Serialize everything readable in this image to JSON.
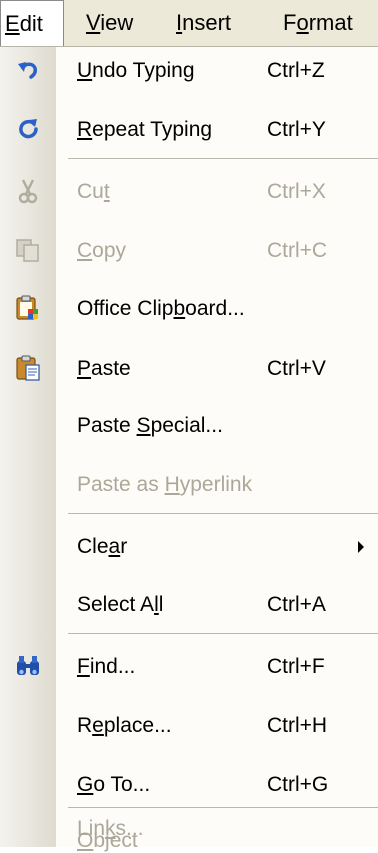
{
  "menubar": {
    "items": [
      {
        "pre": "",
        "key": "E",
        "post": "dit"
      },
      {
        "pre": "",
        "key": "V",
        "post": "iew"
      },
      {
        "pre": "",
        "key": "I",
        "post": "nsert"
      },
      {
        "pre": "F",
        "key": "o",
        "post": "rmat"
      }
    ]
  },
  "menu": {
    "items": [
      {
        "label": {
          "pre": "",
          "key": "U",
          "post": "ndo Typing"
        },
        "shortcut": "Ctrl+Z",
        "icon": "undo-icon"
      },
      {
        "label": {
          "pre": "",
          "key": "R",
          "post": "epeat Typing"
        },
        "shortcut": "Ctrl+Y",
        "icon": "repeat-icon"
      },
      {
        "label": {
          "pre": "Cu",
          "key": "t",
          "post": ""
        },
        "shortcut": "Ctrl+X",
        "icon": "scissors-icon"
      },
      {
        "label": {
          "pre": "",
          "key": "C",
          "post": "opy"
        },
        "shortcut": "Ctrl+C",
        "icon": "copy-icon"
      },
      {
        "label": {
          "pre": "Office Clip",
          "key": "b",
          "post": "oard..."
        },
        "shortcut": "",
        "icon": "office-clipboard-icon"
      },
      {
        "label": {
          "pre": "",
          "key": "P",
          "post": "aste"
        },
        "shortcut": "Ctrl+V",
        "icon": "paste-icon"
      },
      {
        "label": {
          "pre": "Paste ",
          "key": "S",
          "post": "pecial..."
        },
        "shortcut": ""
      },
      {
        "label": {
          "pre": "Paste as ",
          "key": "H",
          "post": "yperlink"
        },
        "shortcut": ""
      },
      {
        "label": {
          "pre": "Cle",
          "key": "a",
          "post": "r"
        },
        "shortcut": "",
        "icon": "submenu-arrow-icon"
      },
      {
        "label": {
          "pre": "Select A",
          "key": "l",
          "post": "l"
        },
        "shortcut": "Ctrl+A"
      },
      {
        "label": {
          "pre": "",
          "key": "F",
          "post": "ind..."
        },
        "shortcut": "Ctrl+F",
        "icon": "binoculars-icon"
      },
      {
        "label": {
          "pre": "R",
          "key": "e",
          "post": "place..."
        },
        "shortcut": "Ctrl+H"
      },
      {
        "label": {
          "pre": "",
          "key": "G",
          "post": "o To..."
        },
        "shortcut": "Ctrl+G"
      },
      {
        "label": {
          "pre": "Lin",
          "key": "k",
          "post": "s..."
        },
        "shortcut": ""
      },
      {
        "label": {
          "pre": "",
          "key": "O",
          "post": "bject"
        },
        "shortcut": ""
      }
    ]
  }
}
